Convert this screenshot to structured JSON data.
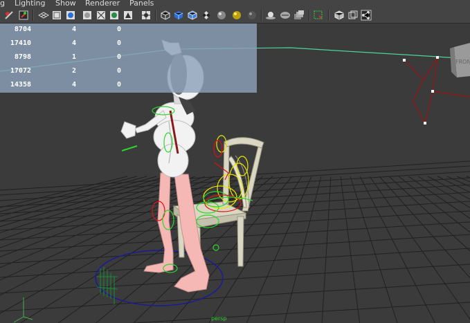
{
  "menu": [
    "g",
    "Lighting",
    "Show",
    "Renderer",
    "Panels"
  ],
  "toolbar_icons": [
    "camera-attributes-icon",
    "bookmark-icon",
    "grid-display-icon",
    "wireframe-icon",
    "smooth-shade-icon",
    "bounding-box-icon",
    "default-material-icon",
    "textured-icon",
    "use-all-lights-icon",
    "shadows-icon",
    "xray-icon",
    "xray-joints-icon",
    "backface-culling-icon",
    "cube-wire-icon",
    "cube-blue-icon",
    "cube-outline-icon",
    "checker-icon",
    "sphere-icon",
    "sphere-yellow-icon",
    "sphere-dark-icon",
    "light-bulb-icon",
    "clip-icon",
    "layers-icon",
    "select-camera-icon",
    "isolate-icon",
    "two-panel-icon",
    "share-icon"
  ],
  "hud": {
    "rows": [
      {
        "a": "8704",
        "b": "4",
        "c": "0"
      },
      {
        "a": "17410",
        "b": "4",
        "c": "0"
      },
      {
        "a": "8798",
        "b": "1",
        "c": "0"
      },
      {
        "a": "17072",
        "b": "2",
        "c": "0"
      },
      {
        "a": "14358",
        "b": "4",
        "c": "0"
      }
    ]
  },
  "colors": {
    "viewport_bg": "#3b3b3b",
    "grid": "#222222",
    "hud_bg": "#8ca0b9",
    "horizon": "#4fd39a",
    "control_red": "#8c1a1a",
    "body": "#f2f2f2",
    "legs": "#f5b8b5",
    "chair": "#d9d6c4"
  },
  "viewcube_label": "FRONT",
  "footer_label": "persp"
}
